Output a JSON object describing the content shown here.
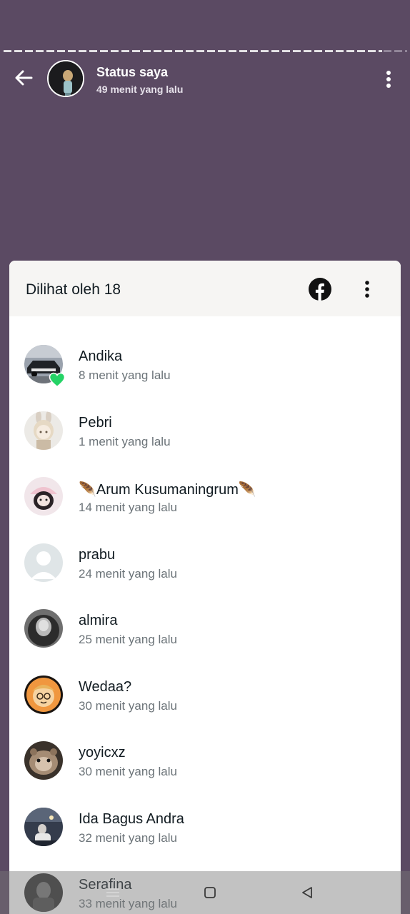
{
  "header": {
    "title": "Status saya",
    "subtitle": "49 menit yang lalu"
  },
  "sheet": {
    "title": "Dilihat oleh 18"
  },
  "viewers": [
    {
      "name": "Andika",
      "time": "8 menit yang lalu",
      "reaction": "heart"
    },
    {
      "name": "Pebri",
      "time": "1 menit yang lalu"
    },
    {
      "name": "🪶Arum Kusumaningrum🪶",
      "time": "14 menit yang lalu"
    },
    {
      "name": "prabu",
      "time": "24 menit yang lalu"
    },
    {
      "name": "almira",
      "time": "25 menit yang lalu"
    },
    {
      "name": "Wedaa?",
      "time": "30 menit yang lalu"
    },
    {
      "name": "yoyicxz",
      "time": "30 menit yang lalu"
    },
    {
      "name": "Ida Bagus Andra",
      "time": "32 menit yang lalu"
    },
    {
      "name": "Serafina",
      "time": "33 menit yang lalu"
    }
  ],
  "colors": {
    "background": "#5b4a63",
    "reaction_heart": "#25d366"
  },
  "icons": {
    "back": "arrow-left-icon",
    "menu": "more-vertical-icon",
    "facebook": "facebook-icon",
    "nav_recent": "menu-lines-icon",
    "nav_home": "square-icon",
    "nav_back": "triangle-back-icon"
  }
}
